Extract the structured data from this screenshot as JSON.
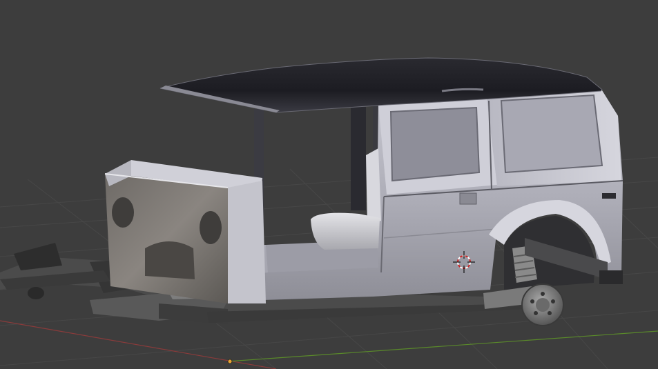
{
  "viewport": {
    "background": "#3d3d3d",
    "grid_color": "#484848",
    "x_axis_color": "#8a3b3b",
    "y_axis_color": "#5a8a2a"
  },
  "scene": {
    "object": "jeep-body-with-chassis",
    "roof_color": "#1f1f24",
    "body_color": "#b4b4bd",
    "frame_color": "#4a4a4a"
  },
  "cursor_3d": {
    "icon": "3d-cursor-icon",
    "color": "#cc2222"
  },
  "origin": {
    "icon": "object-origin-icon",
    "color": "#e8a430"
  }
}
